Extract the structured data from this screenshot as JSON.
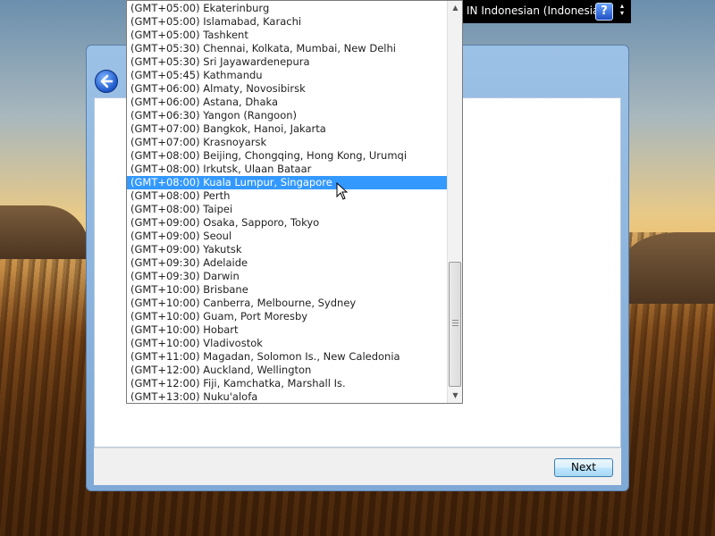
{
  "language_bar": {
    "text": "IN Indonesian (Indonesia)",
    "help_label": "?",
    "menu_glyph": "▴\n▾"
  },
  "wizard": {
    "next_label": "Next"
  },
  "timezone_list": {
    "selected_index": 13,
    "items": [
      "(GMT+05:00) Ekaterinburg",
      "(GMT+05:00) Islamabad, Karachi",
      "(GMT+05:00) Tashkent",
      "(GMT+05:30) Chennai, Kolkata, Mumbai, New Delhi",
      "(GMT+05:30) Sri Jayawardenepura",
      "(GMT+05:45) Kathmandu",
      "(GMT+06:00) Almaty, Novosibirsk",
      "(GMT+06:00) Astana, Dhaka",
      "(GMT+06:30) Yangon (Rangoon)",
      "(GMT+07:00) Bangkok, Hanoi, Jakarta",
      "(GMT+07:00) Krasnoyarsk",
      "(GMT+08:00) Beijing, Chongqing, Hong Kong, Urumqi",
      "(GMT+08:00) Irkutsk, Ulaan Bataar",
      "(GMT+08:00) Kuala Lumpur, Singapore",
      "(GMT+08:00) Perth",
      "(GMT+08:00) Taipei",
      "(GMT+09:00) Osaka, Sapporo, Tokyo",
      "(GMT+09:00) Seoul",
      "(GMT+09:00) Yakutsk",
      "(GMT+09:30) Adelaide",
      "(GMT+09:30) Darwin",
      "(GMT+10:00) Brisbane",
      "(GMT+10:00) Canberra, Melbourne, Sydney",
      "(GMT+10:00) Guam, Port Moresby",
      "(GMT+10:00) Hobart",
      "(GMT+10:00) Vladivostok",
      "(GMT+11:00) Magadan, Solomon Is., New Caledonia",
      "(GMT+12:00) Auckland, Wellington",
      "(GMT+12:00) Fiji, Kamchatka, Marshall Is.",
      "(GMT+13:00) Nuku'alofa"
    ],
    "scroll_up_glyph": "▲",
    "scroll_down_glyph": "▼"
  },
  "colors": {
    "selection": "#3399ff",
    "window_frame": "#9cc1e6",
    "accent_button": "#1d57c9"
  }
}
